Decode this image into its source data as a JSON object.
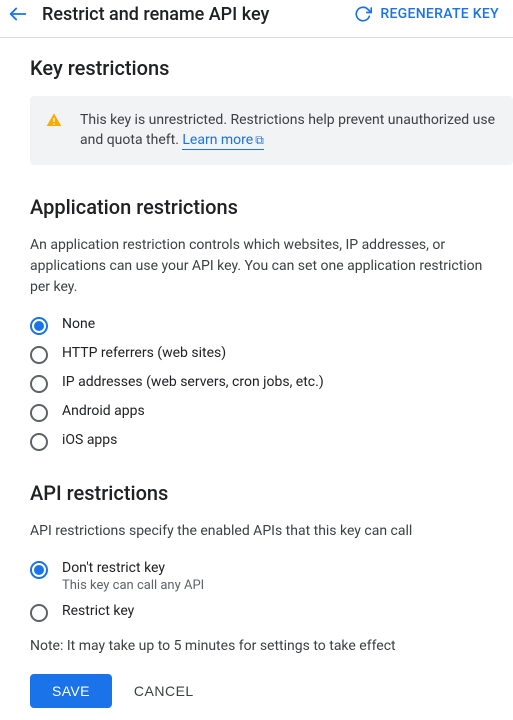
{
  "header": {
    "title": "Restrict and rename API key",
    "regenerate": "REGENERATE KEY"
  },
  "key_restrictions": {
    "heading": "Key restrictions",
    "info_text": "This key is unrestricted. Restrictions help prevent unauthorized use and quota theft. ",
    "learn_more": "Learn more"
  },
  "app_restrictions": {
    "heading": "Application restrictions",
    "description": "An application restriction controls which websites, IP addresses, or applications can use your API key. You can set one application restriction per key.",
    "options": [
      {
        "label": "None",
        "checked": true
      },
      {
        "label": "HTTP referrers (web sites)",
        "checked": false
      },
      {
        "label": "IP addresses (web servers, cron jobs, etc.)",
        "checked": false
      },
      {
        "label": "Android apps",
        "checked": false
      },
      {
        "label": "iOS apps",
        "checked": false
      }
    ]
  },
  "api_restrictions": {
    "heading": "API restrictions",
    "description": "API restrictions specify the enabled APIs that this key can call",
    "options": [
      {
        "label": "Don't restrict key",
        "sub": "This key can call any API",
        "checked": true
      },
      {
        "label": "Restrict key",
        "checked": false
      }
    ]
  },
  "note": "Note: It may take up to 5 minutes for settings to take effect",
  "actions": {
    "save": "SAVE",
    "cancel": "CANCEL"
  }
}
